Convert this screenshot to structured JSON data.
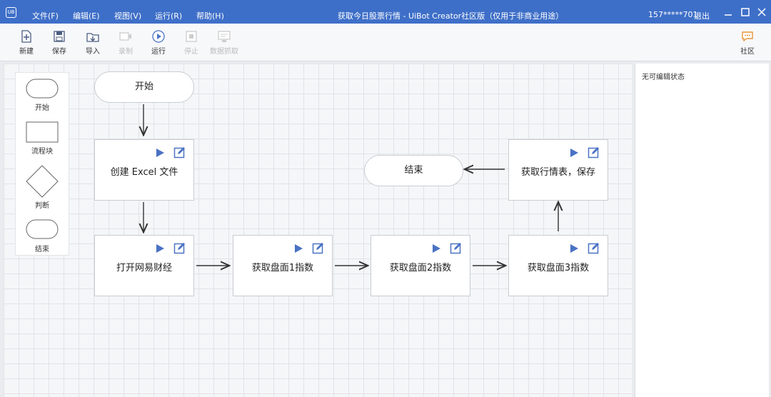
{
  "window": {
    "logo": "UB",
    "title": "获取今日股票行情 - UiBot Creator社区版（仅用于非商业用途）",
    "user": "157*****701",
    "logout": "退出"
  },
  "menu": [
    "文件(F)",
    "编辑(E)",
    "视图(V)",
    "运行(R)",
    "帮助(H)"
  ],
  "toolbar": {
    "new": "新建",
    "save": "保存",
    "import": "导入",
    "record": "录制",
    "run": "运行",
    "stop": "停止",
    "data_scrape": "数据抓取",
    "community": "社区"
  },
  "palette": {
    "start": "开始",
    "block": "流程块",
    "decision": "判断",
    "end": "结束"
  },
  "flow": {
    "start": "开始",
    "end": "结束",
    "blocks": [
      "创建 Excel 文件",
      "打开网易财经",
      "获取盘面1指数",
      "获取盘面2指数",
      "获取盘面3指数",
      "获取行情表，保存"
    ]
  },
  "panel": {
    "status": "无可编辑状态"
  },
  "colors": {
    "titlebar": "#3e6fc8",
    "accent": "#4a72c4"
  }
}
